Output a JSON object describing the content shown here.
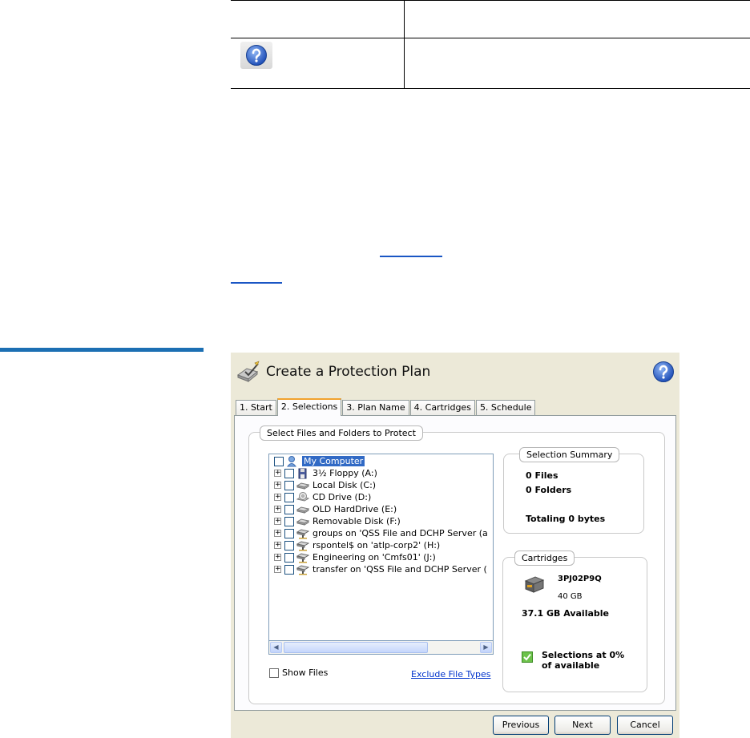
{
  "dialog": {
    "title": "Create a Protection Plan",
    "tabs": [
      {
        "label": "1. Start"
      },
      {
        "label": "2. Selections"
      },
      {
        "label": "3. Plan Name"
      },
      {
        "label": "4. Cartridges"
      },
      {
        "label": "5. Schedule"
      }
    ],
    "active_tab": "2. Selections",
    "select_group_label": "Select Files and Folders to Protect",
    "tree": [
      {
        "label": "My Computer",
        "icon": "computer-icon",
        "expander": false,
        "checked": false,
        "selected": true
      },
      {
        "label": "3½ Floppy (A:)",
        "icon": "floppy-icon",
        "expander": true,
        "checked": false
      },
      {
        "label": "Local Disk (C:)",
        "icon": "hard-drive-icon",
        "expander": true,
        "checked": false
      },
      {
        "label": "CD Drive (D:)",
        "icon": "cd-drive-icon",
        "expander": true,
        "checked": false
      },
      {
        "label": "OLD HardDrive (E:)",
        "icon": "hard-drive-icon",
        "expander": true,
        "checked": false
      },
      {
        "label": "Removable Disk (F:)",
        "icon": "removable-disk-icon",
        "expander": true,
        "checked": false
      },
      {
        "label": "groups on 'QSS File and DCHP Server (a",
        "icon": "network-drive-icon",
        "expander": true,
        "checked": false
      },
      {
        "label": "rspontel$ on 'atlp-corp2' (H:)",
        "icon": "network-drive-icon",
        "expander": true,
        "checked": false
      },
      {
        "label": "Engineering on 'Cmfs01' (J:)",
        "icon": "network-drive-icon",
        "expander": true,
        "checked": false
      },
      {
        "label": "transfer on 'QSS File and DCHP Server (",
        "icon": "network-drive-icon",
        "expander": true,
        "checked": false
      }
    ],
    "show_files_label": "Show Files",
    "show_files_checked": false,
    "exclude_link": "Exclude File Types",
    "summary": {
      "title": "Selection Summary",
      "files": "0 Files",
      "folders": "0 Folders",
      "total": "Totaling 0 bytes"
    },
    "cartridges": {
      "title": "Cartridges",
      "id": "3PJ02P9Q",
      "capacity": "40 GB",
      "available": "37.1 GB Available",
      "selections_line1": "Selections at 0%",
      "selections_line2": "of available"
    },
    "buttons": {
      "previous": "Previous",
      "next": "Next",
      "cancel": "Cancel"
    }
  },
  "colors": {
    "accent_rule": "#1c6fb3",
    "selection": "#316ac5",
    "link": "#0033cc",
    "active_tab_accent": "#f1a22e"
  }
}
